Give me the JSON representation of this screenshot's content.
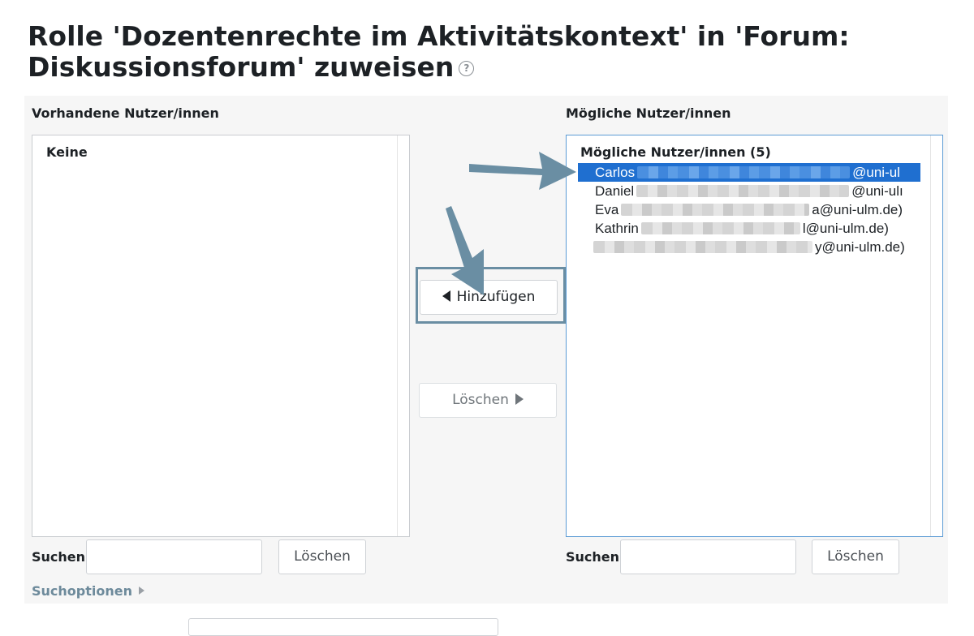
{
  "page": {
    "title": "Rolle 'Dozentenrechte im Aktivitätskontext' in 'Forum: Diskussionsforum' zuweisen",
    "help_icon": "question-circle-icon"
  },
  "existing_users": {
    "label": "Vorhandene Nutzer/innen",
    "empty_text": "Keine",
    "search_label": "Suchen",
    "search_value": "",
    "clear_label": "Löschen"
  },
  "potential_users": {
    "label": "Mögliche Nutzer/innen",
    "group_label": "Mögliche Nutzer/innen (5)",
    "items": [
      {
        "first": "Carlos",
        "suffix": "@uni-ul",
        "selected": true
      },
      {
        "first": "Daniel",
        "suffix": "@uni-ulı",
        "selected": false
      },
      {
        "first": "Eva",
        "suffix": "a@uni-ulm.de)",
        "selected": false
      },
      {
        "first": "Kathrin",
        "suffix": "l@uni-ulm.de)",
        "selected": false
      },
      {
        "first": "",
        "suffix": "y@uni-ulm.de)",
        "selected": false
      }
    ],
    "search_label": "Suchen",
    "search_value": "",
    "clear_label": "Löschen"
  },
  "actions": {
    "add_label": "Hinzufügen",
    "remove_label": "Löschen",
    "add_icon": "triangle-left-icon",
    "remove_icon": "triangle-right-icon"
  },
  "search_options": {
    "label": "Suchoptionen",
    "icon": "triangle-right-icon"
  },
  "colors": {
    "selected_bg": "#1f6fd0",
    "annotation_arrow": "#6a8ea3",
    "link": "#6d8a9b"
  }
}
